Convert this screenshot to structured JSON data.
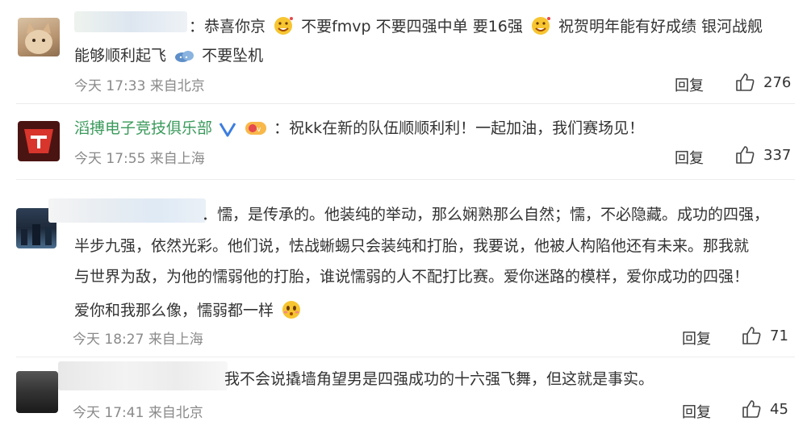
{
  "comments": [
    {
      "lines": [
        "：恭喜你京",
        "不要fmvp 不要四强中单 要16强",
        "祝贺明年能有好成绩 银河战舰",
        "能够顺利起飞",
        "不要坠机"
      ],
      "time": "今天 17:33",
      "location": "来自北京",
      "reply": "回复",
      "likes": "276"
    },
    {
      "username": "滔搏电子竞技俱乐部",
      "lines": [
        "：祝kk在新的队伍顺顺利利！一起加油，我们赛场见！"
      ],
      "time": "今天 17:55",
      "location": "来自上海",
      "reply": "回复",
      "likes": "337"
    },
    {
      "lines": [
        "．懦，是传承的。他装纯的举动，那么娴熟那么自然；懦，不必隐藏。成功的四强，",
        "半步九强，依然光彩。他们说，怯战蜥蜴只会装纯和打胎，我要说，他被人构陷他还有未来。那我就",
        "与世界为敌，为他的懦弱他的打胎，谁说懦弱的人不配打比赛。爱你迷路的模样，爱你成功的四强！",
        "爱你和我那么像，懦弱都一样"
      ],
      "time": "今天 18:27",
      "location": "来自上海",
      "reply": "回复",
      "likes": "71"
    },
    {
      "lines": [
        "我不会说撬墙角望男是四强成功的十六强飞舞，但这就是事实。"
      ],
      "time": "今天 17:41",
      "location": "来自北京",
      "reply": "回复",
      "likes": "45"
    }
  ],
  "colors": {
    "username": "#3a9a5b",
    "meta": "#8a8a8a",
    "verified": "#3d7de0",
    "text": "#333333"
  }
}
